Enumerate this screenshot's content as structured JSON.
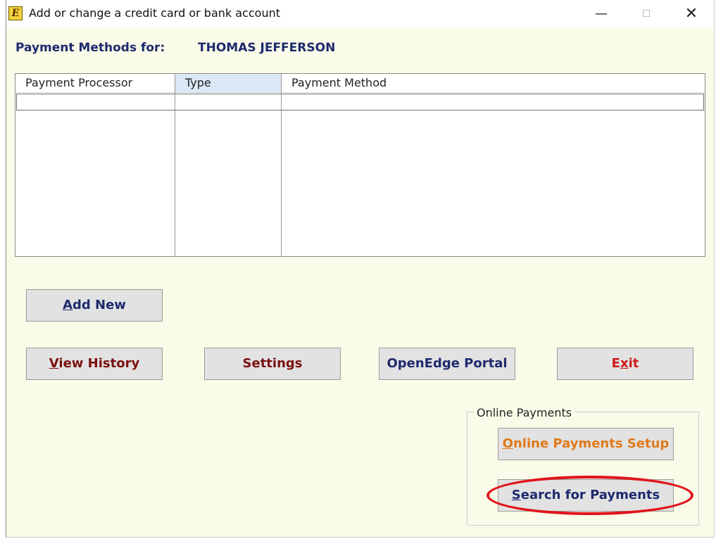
{
  "window": {
    "title": "Add or change a credit card or bank account",
    "icon": "app-icon",
    "icon_glyph": "E",
    "controls": {
      "minimize": "—",
      "maximize": "☐",
      "close": "✕"
    }
  },
  "header": {
    "label": "Payment Methods for:",
    "customer_name": "THOMAS JEFFERSON"
  },
  "grid": {
    "columns": [
      "Payment Processor",
      "Type",
      "Payment Method"
    ],
    "rows": []
  },
  "buttons": {
    "add_new": {
      "mnemonic": "A",
      "rest": "dd New"
    },
    "view_history": {
      "mnemonic": "V",
      "rest": "iew History"
    },
    "settings": "Settings",
    "openedge_portal": "OpenEdge Portal",
    "exit": {
      "before": "E",
      "mnemonic": "x",
      "after": "it"
    }
  },
  "online_payments": {
    "group_label": "Online Payments",
    "setup": {
      "mnemonic": "O",
      "rest": "nline Payments Setup"
    },
    "search": {
      "mnemonic": "S",
      "rest": "earch for Payments"
    }
  },
  "colors": {
    "window_bg": "#fafbe8",
    "navy_text": "#1d2a6e",
    "maroon_text": "#7a1010",
    "red_text": "#d01818",
    "orange_text": "#e07a1a",
    "highlight": "#e0141b"
  }
}
